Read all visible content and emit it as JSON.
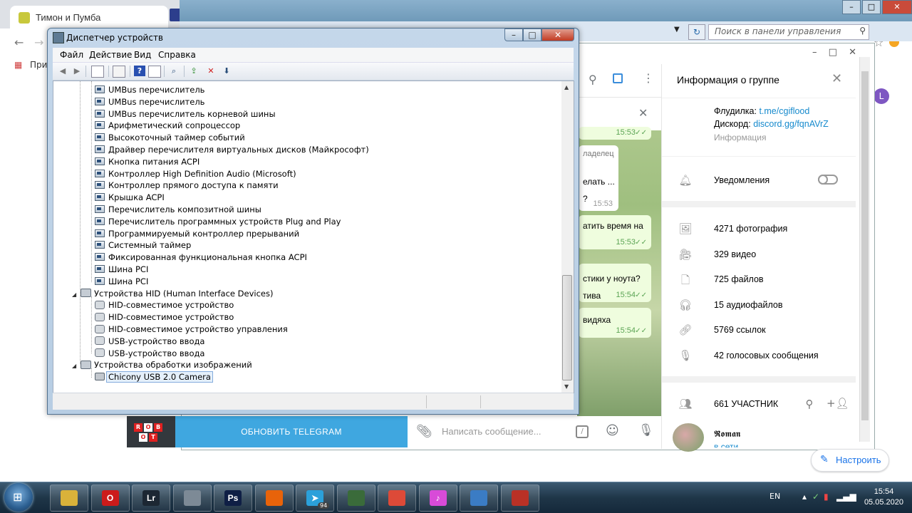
{
  "browser": {
    "tab_title": "Тимон и Пумба",
    "bookmark_label": "При",
    "setup_button": "Настроить",
    "profile_initial": "L"
  },
  "control_panel": {
    "search_placeholder": "Поиск в панели управления"
  },
  "telegram": {
    "info_title": "Информация о группе",
    "floodilka_label": "Флудилка:",
    "floodilka_link": "t.me/cgiflood",
    "discord_label": "Дискорд:",
    "discord_link": "discord.gg/fqnAVrZ",
    "info_caption": "Информация",
    "notifications_label": "Уведомления",
    "media": [
      {
        "icon": "photo-icon",
        "label": "4271 фотография"
      },
      {
        "icon": "video-icon",
        "label": "329 видео"
      },
      {
        "icon": "file-icon",
        "label": "725 файлов"
      },
      {
        "icon": "headphones-icon",
        "label": "15 аудиофайлов"
      },
      {
        "icon": "link-icon",
        "label": "5769 ссылок"
      },
      {
        "icon": "microphone-icon",
        "label": "42 голосовых сообщения"
      }
    ],
    "members_label": "661 УЧАСТНИК",
    "member_name": "𝕽𝖔𝖒𝖆𝖓",
    "member_status": "в сети",
    "update_button": "ОБНОВИТЬ TELEGRAM",
    "composer_placeholder": "Написать сообщение...",
    "robot_letters": [
      "R",
      "O",
      "B",
      "O",
      "T"
    ],
    "messages": [
      {
        "text": "",
        "time": "15:53",
        "read": true
      },
      {
        "text": "ладелец",
        "time": "",
        "read": false
      },
      {
        "text": "елать ...",
        "time": "",
        "read": false
      },
      {
        "text": "?",
        "time": "15:53",
        "read": false
      },
      {
        "text": "атить время на",
        "time": "15:53",
        "read": true
      },
      {
        "text": "стики у ноута?",
        "time": "",
        "read": false
      },
      {
        "text": "тива",
        "time": "15:54",
        "read": true
      },
      {
        "text": "видяха",
        "time": "15:54",
        "read": true
      }
    ]
  },
  "device_manager": {
    "title": "Диспетчер устройств",
    "menu": [
      "Файл",
      "Действие",
      "Вид",
      "Справка"
    ],
    "system_devices": [
      "UMBus перечислитель",
      "UMBus перечислитель",
      "UMBus перечислитель корневой шины",
      "Арифметический сопроцессор",
      "Высокоточный таймер событий",
      "Драйвер перечислителя виртуальных дисков (Майкрософт)",
      "Кнопка питания ACPI",
      "Контроллер High Definition Audio (Microsoft)",
      "Контроллер прямого доступа к памяти",
      "Крышка ACPI",
      "Перечислитель композитной шины",
      "Перечислитель программных устройств Plug and Play",
      "Программируемый контроллер прерываний",
      "Системный таймер",
      "Фиксированная функциональная кнопка ACPI",
      "Шина PCI",
      "Шина PCI"
    ],
    "hid_category": "Устройства HID (Human Interface Devices)",
    "hid_devices": [
      "HID-совместимое устройство",
      "HID-совместимое устройство",
      "HID-совместимое устройство управления",
      "USB-устройство ввода",
      "USB-устройство ввода"
    ],
    "imaging_category": "Устройства обработки изображений",
    "imaging_devices": [
      "Chicony USB 2.0 Camera"
    ]
  },
  "taskbar": {
    "lang": "EN",
    "time": "15:54",
    "date": "05.05.2020",
    "telegram_badge": "94",
    "apps": [
      {
        "icon": "file-explorer-icon",
        "glyph": "",
        "color": "#d9b23a"
      },
      {
        "icon": "opera-icon",
        "glyph": "O",
        "color": "#cc1b1b"
      },
      {
        "icon": "lightroom-icon",
        "glyph": "Lr",
        "color": "#1c2733"
      },
      {
        "icon": "calculator-icon",
        "glyph": "",
        "color": "#7d8a96"
      },
      {
        "icon": "photoshop-icon",
        "glyph": "Ps",
        "color": "#0f1f45"
      },
      {
        "icon": "firefox-icon",
        "glyph": "",
        "color": "#e8630a"
      },
      {
        "icon": "telegram-icon",
        "glyph": "➤",
        "color": "#2ba0da"
      },
      {
        "icon": "task-manager-icon",
        "glyph": "",
        "color": "#3a6b3a"
      },
      {
        "icon": "chrome-icon",
        "glyph": "",
        "color": "#dd4a38"
      },
      {
        "icon": "itunes-icon",
        "glyph": "♪",
        "color": "#d84bd8"
      },
      {
        "icon": "control-panel-icon",
        "glyph": "",
        "color": "#3b7cc4"
      },
      {
        "icon": "device-manager-icon",
        "glyph": "",
        "color": "#b93126"
      }
    ]
  }
}
